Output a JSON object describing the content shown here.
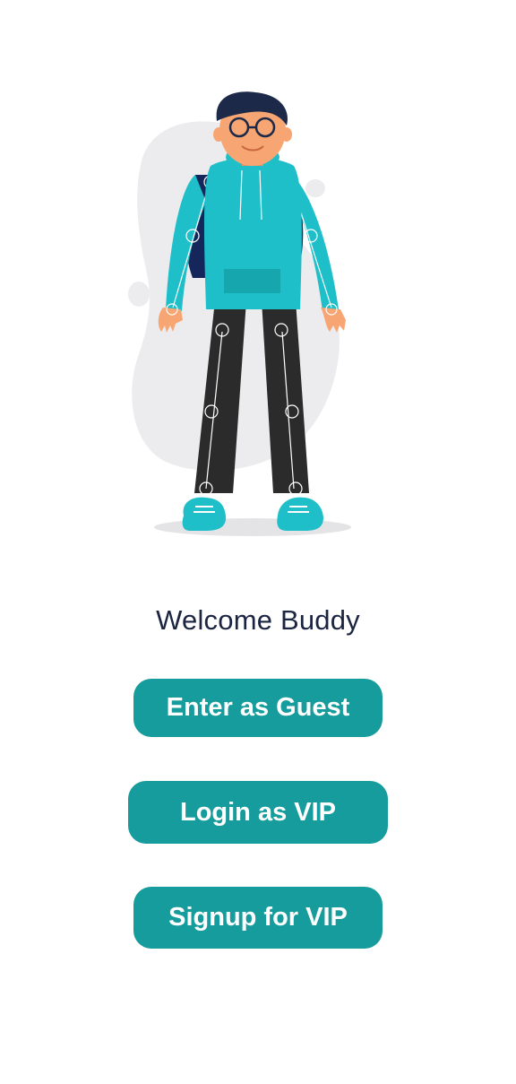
{
  "welcome": {
    "text": "Welcome Buddy"
  },
  "buttons": {
    "guest": "Enter as Guest",
    "login": "Login as VIP",
    "signup": "Signup for VIP"
  },
  "colors": {
    "accent": "#169c9c",
    "hoodie": "#1fbfc9",
    "pants": "#2b2b2b",
    "blob": "#ececee",
    "title": "#1b2440"
  }
}
